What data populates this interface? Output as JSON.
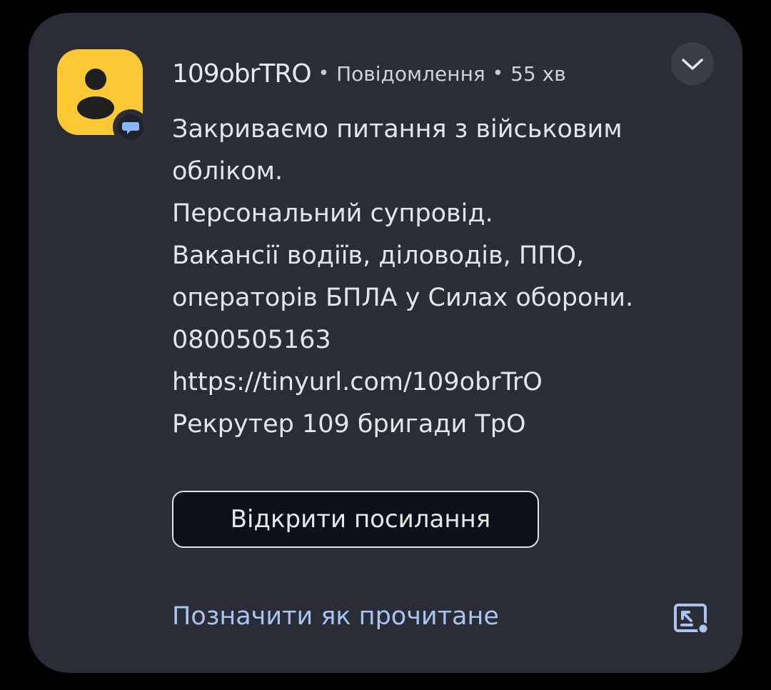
{
  "notification": {
    "sender": "109obrTRO",
    "app_name": "Повідомлення",
    "time": "55 хв",
    "separator": "•",
    "body_lines": [
      "Закриваємо питання з військовим",
      "обліком.",
      "Персональний супровід.",
      "Вакансії водіїв, діловодів, ППО,",
      "операторів БПЛА у Силах оборони.",
      "0800505163",
      "https://tinyurl.com/109obrTrO",
      "Рекрутер 109 бригади ТрО"
    ],
    "open_link_label": "Відкрити посилання",
    "mark_read_label": "Позначити як прочитане",
    "icons": {
      "avatar": "person-icon",
      "badge": "chat-bubble-icon",
      "expand": "chevron-down-icon",
      "pip": "picture-in-picture-icon"
    }
  },
  "colors": {
    "card_background": "#2a2d35",
    "avatar_background": "#fcc934",
    "action_link": "#a9c4f2"
  }
}
